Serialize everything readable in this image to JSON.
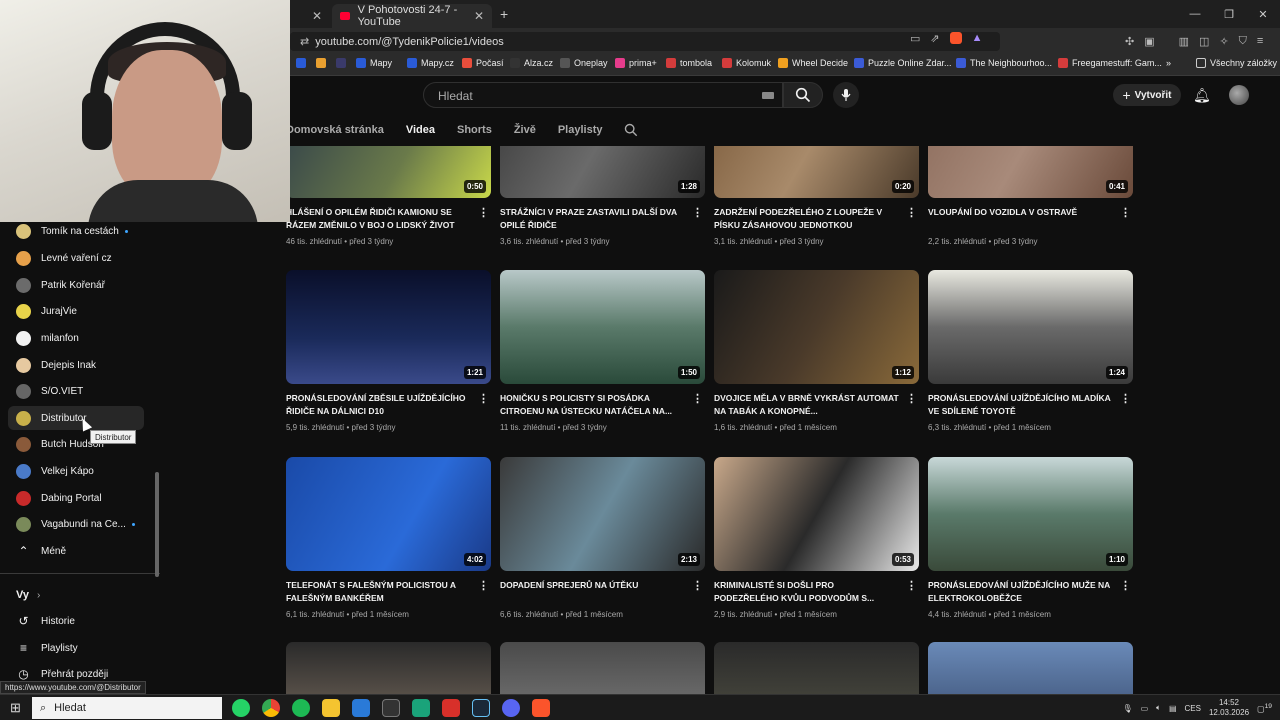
{
  "browser": {
    "tabs": [
      {
        "label": ""
      },
      {
        "label": "V Pohotovosti 24-7 - YouTube"
      }
    ],
    "url": "youtube.com/@TydenikPolicie1/videos",
    "status_url": "https://www.youtube.com/@Distributor",
    "bookmarks": [
      {
        "label": "Mapy",
        "color": "#2a5bd7"
      },
      {
        "label": "Mapy.cz",
        "color": "#2a5bd7"
      },
      {
        "label": "Počasí",
        "color": "#e94e3c"
      },
      {
        "label": "Alza.cz",
        "color": "#333333"
      },
      {
        "label": "Oneplay",
        "color": "#444444"
      },
      {
        "label": "prima+",
        "color": "#e63c8c"
      },
      {
        "label": "tombola",
        "color": "#d43c3c"
      },
      {
        "label": "Kolomuk",
        "color": "#d43c3c"
      },
      {
        "label": "Wheel Decide",
        "color": "#f0a020"
      },
      {
        "label": "Puzzle Online Zdar...",
        "color": "#3b5bd6"
      },
      {
        "label": "The Neighbourhoo...",
        "color": "#3b5bd6"
      },
      {
        "label": "Freegamestuff: Gam...",
        "color": "#d43c3c"
      }
    ],
    "all_bookmarks": "Všechny záložky"
  },
  "youtube": {
    "search_placeholder": "Hledat",
    "create_label": "Vytvořit",
    "channel_tabs": [
      "Domovská stránka",
      "Videa",
      "Shorts",
      "Živě",
      "Playlisty"
    ],
    "selected_tab": "Videa"
  },
  "sidebar": {
    "subscriptions": [
      {
        "label": "Tomík na cestách",
        "dot": true,
        "color": "#d9c27a"
      },
      {
        "label": "Levné vaření cz",
        "dot": false,
        "color": "#e6a04a"
      },
      {
        "label": "Patrik Kořenář",
        "dot": false,
        "color": "#6b6b6b"
      },
      {
        "label": "JurajVie",
        "dot": false,
        "color": "#e8d34a"
      },
      {
        "label": "milanfon",
        "dot": false,
        "color": "#f1f1f1"
      },
      {
        "label": "Dejepis Inak",
        "dot": false,
        "color": "#e6c9a0"
      },
      {
        "label": "S/O.VIET",
        "dot": false,
        "color": "#666666"
      },
      {
        "label": "Distributor",
        "dot": false,
        "color": "#c8b04a"
      },
      {
        "label": "Butch Hudson",
        "dot": false,
        "color": "#8a5a3a"
      },
      {
        "label": "Velkej Kápo",
        "dot": false,
        "color": "#4a7ac8"
      },
      {
        "label": "Dabing Portal",
        "dot": false,
        "color": "#c82a2a"
      },
      {
        "label": "Vagabundi na Ce...",
        "dot": true,
        "color": "#7a8a5a"
      }
    ],
    "less_label": "Méně",
    "you_label": "Vy",
    "you_items": [
      "Historie",
      "Playlisty",
      "Přehrát později"
    ],
    "tooltip": "Distributor"
  },
  "videos": [
    {
      "title": "HLÁŠENÍ O OPILÉM ŘIDIČI KAMIONU SE RÁZEM ZMĚNILO V BOJ O LIDSKÝ ŽIVOT",
      "meta": "46 tis. zhlédnutí • před 3 týdny",
      "duration": "0:50",
      "bg": "linear-gradient(120deg,#2b3a4a,#6a7a4a 60%,#c8d84a)"
    },
    {
      "title": "STRÁŽNÍCI V PRAZE ZASTAVILI DALŠÍ DVA OPILÉ ŘIDIČE",
      "meta": "3,6 tis. zhlédnutí • před 3 týdny",
      "duration": "1:28",
      "bg": "linear-gradient(120deg,#3a3a3a,#6a6a6a 50%,#2a2a2a)"
    },
    {
      "title": "ZADRŽENÍ PODEZŘELÉHO Z LOUPEŽE V PÍSKU ZÁSAHOVOU JEDNOTKOU",
      "meta": "3,1 tis. zhlédnutí • před 3 týdny",
      "duration": "0:20",
      "bg": "linear-gradient(120deg,#7a5a3a,#a88a6a 50%,#4a3a2a)"
    },
    {
      "title": "VLOUPÁNÍ DO VOZIDLA V OSTRAVĚ",
      "meta": "2,2 tis. zhlédnutí • před 3 týdny",
      "duration": "0:41",
      "bg": "linear-gradient(120deg,#8a6a5a,#a88a7a 50%,#6a4a3a)"
    },
    {
      "title": "PRONÁSLEDOVÁNÍ ZBĚSILE UJÍŽDĚJÍCÍHO ŘIDIČE NA DÁLNICI D10",
      "meta": "5,9 tis. zhlédnutí • před 3 týdny",
      "duration": "1:21",
      "bg": "linear-gradient(180deg,#0a0f2a,#1a2a5a 60%,#3a4a8a)"
    },
    {
      "title": "HONIČKU S POLICISTY SI POSÁDKA CITROENU NA ÚSTECKU NATÁČELA NA...",
      "meta": "11 tis. zhlédnutí • před 3 týdny",
      "duration": "1:50",
      "bg": "linear-gradient(180deg,#b8c8c8,#5a7a6a 50%,#2a4a3a)"
    },
    {
      "title": "DVOJICE MĚLA V BRNĚ VYKRÁST AUTOMAT NA TABÁK A KONOPNÉ...",
      "meta": "1,6 tis. zhlédnutí • před 1 měsícem",
      "duration": "1:12",
      "bg": "linear-gradient(120deg,#1a1a1a,#4a3a2a 50%,#8a6a3a)"
    },
    {
      "title": "PRONÁSLEDOVÁNÍ UJÍŽDĚJÍCÍHO MLADÍKA VE SDÍLENÉ TOYOTĚ",
      "meta": "6,3 tis. zhlédnutí • před 1 měsícem",
      "duration": "1:24",
      "bg": "linear-gradient(180deg,#e8e8e0,#6a6a6a 50%,#3a3a3a)"
    },
    {
      "title": "TELEFONÁT S FALEŠNÝM POLICISTOU A FALEŠNÝM BANKÉŘEM",
      "meta": "6,1 tis. zhlédnutí • před 1 měsícem",
      "duration": "4:02",
      "bg": "linear-gradient(120deg,#1a4aa8,#2a6ad8 60%,#1a3a88)"
    },
    {
      "title": "DOPADENÍ SPREJERŮ NA ÚTĚKU",
      "meta": "6,6 tis. zhlédnutí • před 1 měsícem",
      "duration": "2:13",
      "bg": "linear-gradient(120deg,#3a3a3a,#6a8a9a 50%,#2a2a2a)"
    },
    {
      "title": "KRIMINALISTÉ SI DOŠLI PRO PODEZŘELÉHO KVŮLI PODVODŮM S...",
      "meta": "2,9 tis. zhlédnutí • před 1 měsícem",
      "duration": "0:53",
      "bg": "linear-gradient(120deg,#c8a88a,#2a2a2a 50%,#e8e8e8)"
    },
    {
      "title": "PRONÁSLEDOVÁNÍ UJÍŽDĚJÍCÍHO MUŽE NA ELEKTROKOLOBĚŽCE",
      "meta": "4,4 tis. zhlédnutí • před 1 měsícem",
      "duration": "1:10",
      "bg": "linear-gradient(180deg,#c8d8d8,#5a7a6a 50%,#3a4a3a)"
    },
    {
      "title": "",
      "meta": "",
      "duration": "",
      "bg": "linear-gradient(180deg,#2a2a2a,#8a7a6a)"
    },
    {
      "title": "",
      "meta": "",
      "duration": "",
      "bg": "linear-gradient(180deg,#4a4a4a,#8a8a8a)"
    },
    {
      "title": "",
      "meta": "",
      "duration": "",
      "bg": "linear-gradient(180deg,#2a2a2a,#5a5a4a)"
    },
    {
      "title": "",
      "meta": "",
      "duration": "",
      "bg": "linear-gradient(180deg,#6a8ab8,#2a3a5a)"
    }
  ],
  "taskbar": {
    "search_placeholder": "Hledat",
    "lang": "CES",
    "time": "14:52",
    "date": "12.03.2026",
    "notif_count": "19"
  }
}
